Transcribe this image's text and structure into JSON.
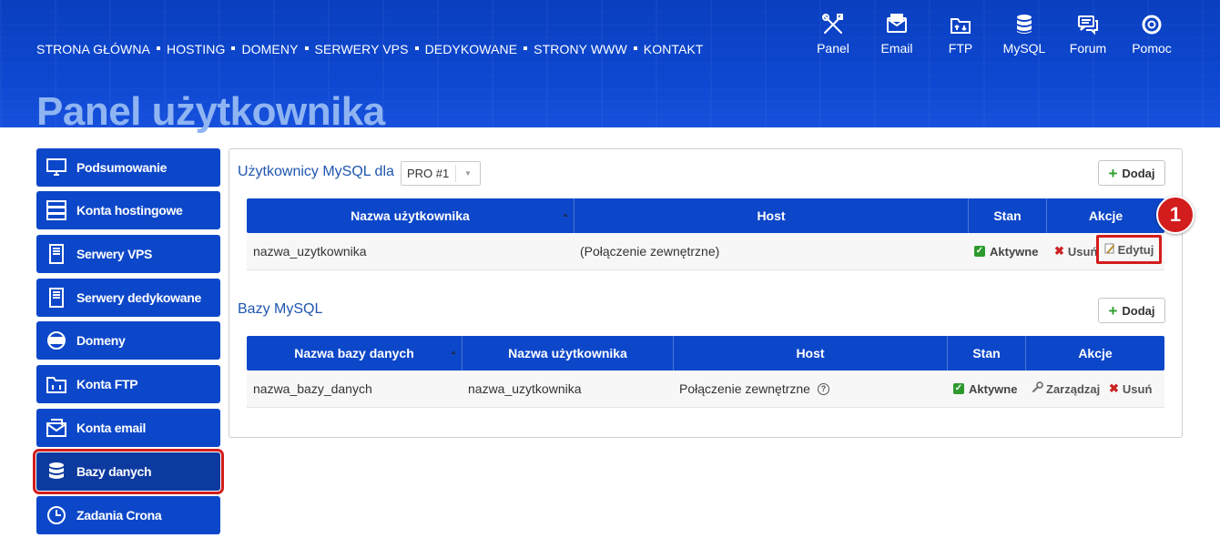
{
  "topnav": {
    "items": [
      "STRONA GŁÓWNA",
      "HOSTING",
      "DOMENY",
      "SERWERY VPS",
      "DEDYKOWANE",
      "STRONY WWW",
      "KONTAKT"
    ]
  },
  "quicklinks": {
    "panel": "Panel",
    "email": "Email",
    "ftp": "FTP",
    "mysql": "MySQL",
    "forum": "Forum",
    "pomoc": "Pomoc"
  },
  "page_title": "Panel użytkownika",
  "sidebar": {
    "items": [
      {
        "label": "Podsumowanie",
        "icon": "monitor-icon"
      },
      {
        "label": "Konta hostingowe",
        "icon": "server-icon"
      },
      {
        "label": "Serwery VPS",
        "icon": "vps-icon"
      },
      {
        "label": "Serwery dedykowane",
        "icon": "dedicated-server-icon"
      },
      {
        "label": "Domeny",
        "icon": "globe-www-icon"
      },
      {
        "label": "Konta FTP",
        "icon": "ftp-folder-icon"
      },
      {
        "label": "Konta email",
        "icon": "mail-icon"
      },
      {
        "label": "Bazy danych",
        "icon": "database-icon",
        "active": true
      },
      {
        "label": "Zadania Crona",
        "icon": "clock-icon"
      }
    ]
  },
  "users_section": {
    "title": "Użytkownicy MySQL dla",
    "select_value": "PRO #1",
    "add_label": "Dodaj",
    "columns": [
      "Nazwa użytkownika",
      "Host",
      "Stan",
      "Akcje"
    ],
    "row": {
      "name": "nazwa_uzytkownika",
      "host": "(Połączenie zewnętrzne)",
      "status": "Aktywne",
      "delete": "Usuń",
      "edit": "Edytuj"
    }
  },
  "databases_section": {
    "title": "Bazy MySQL",
    "add_label": "Dodaj",
    "columns": [
      "Nazwa bazy danych",
      "Nazwa użytkownika",
      "Host",
      "Stan",
      "Akcje"
    ],
    "row": {
      "db_name": "nazwa_bazy_danych",
      "user": "nazwa_uzytkownika",
      "host": "Połączenie zewnętrzne",
      "status": "Aktywne",
      "manage": "Zarządzaj",
      "delete": "Usuń"
    }
  },
  "annotation": {
    "number": "1"
  },
  "colors": {
    "primary": "#0d47c9",
    "highlight": "#d31c1c",
    "success": "#2e9a2e"
  }
}
